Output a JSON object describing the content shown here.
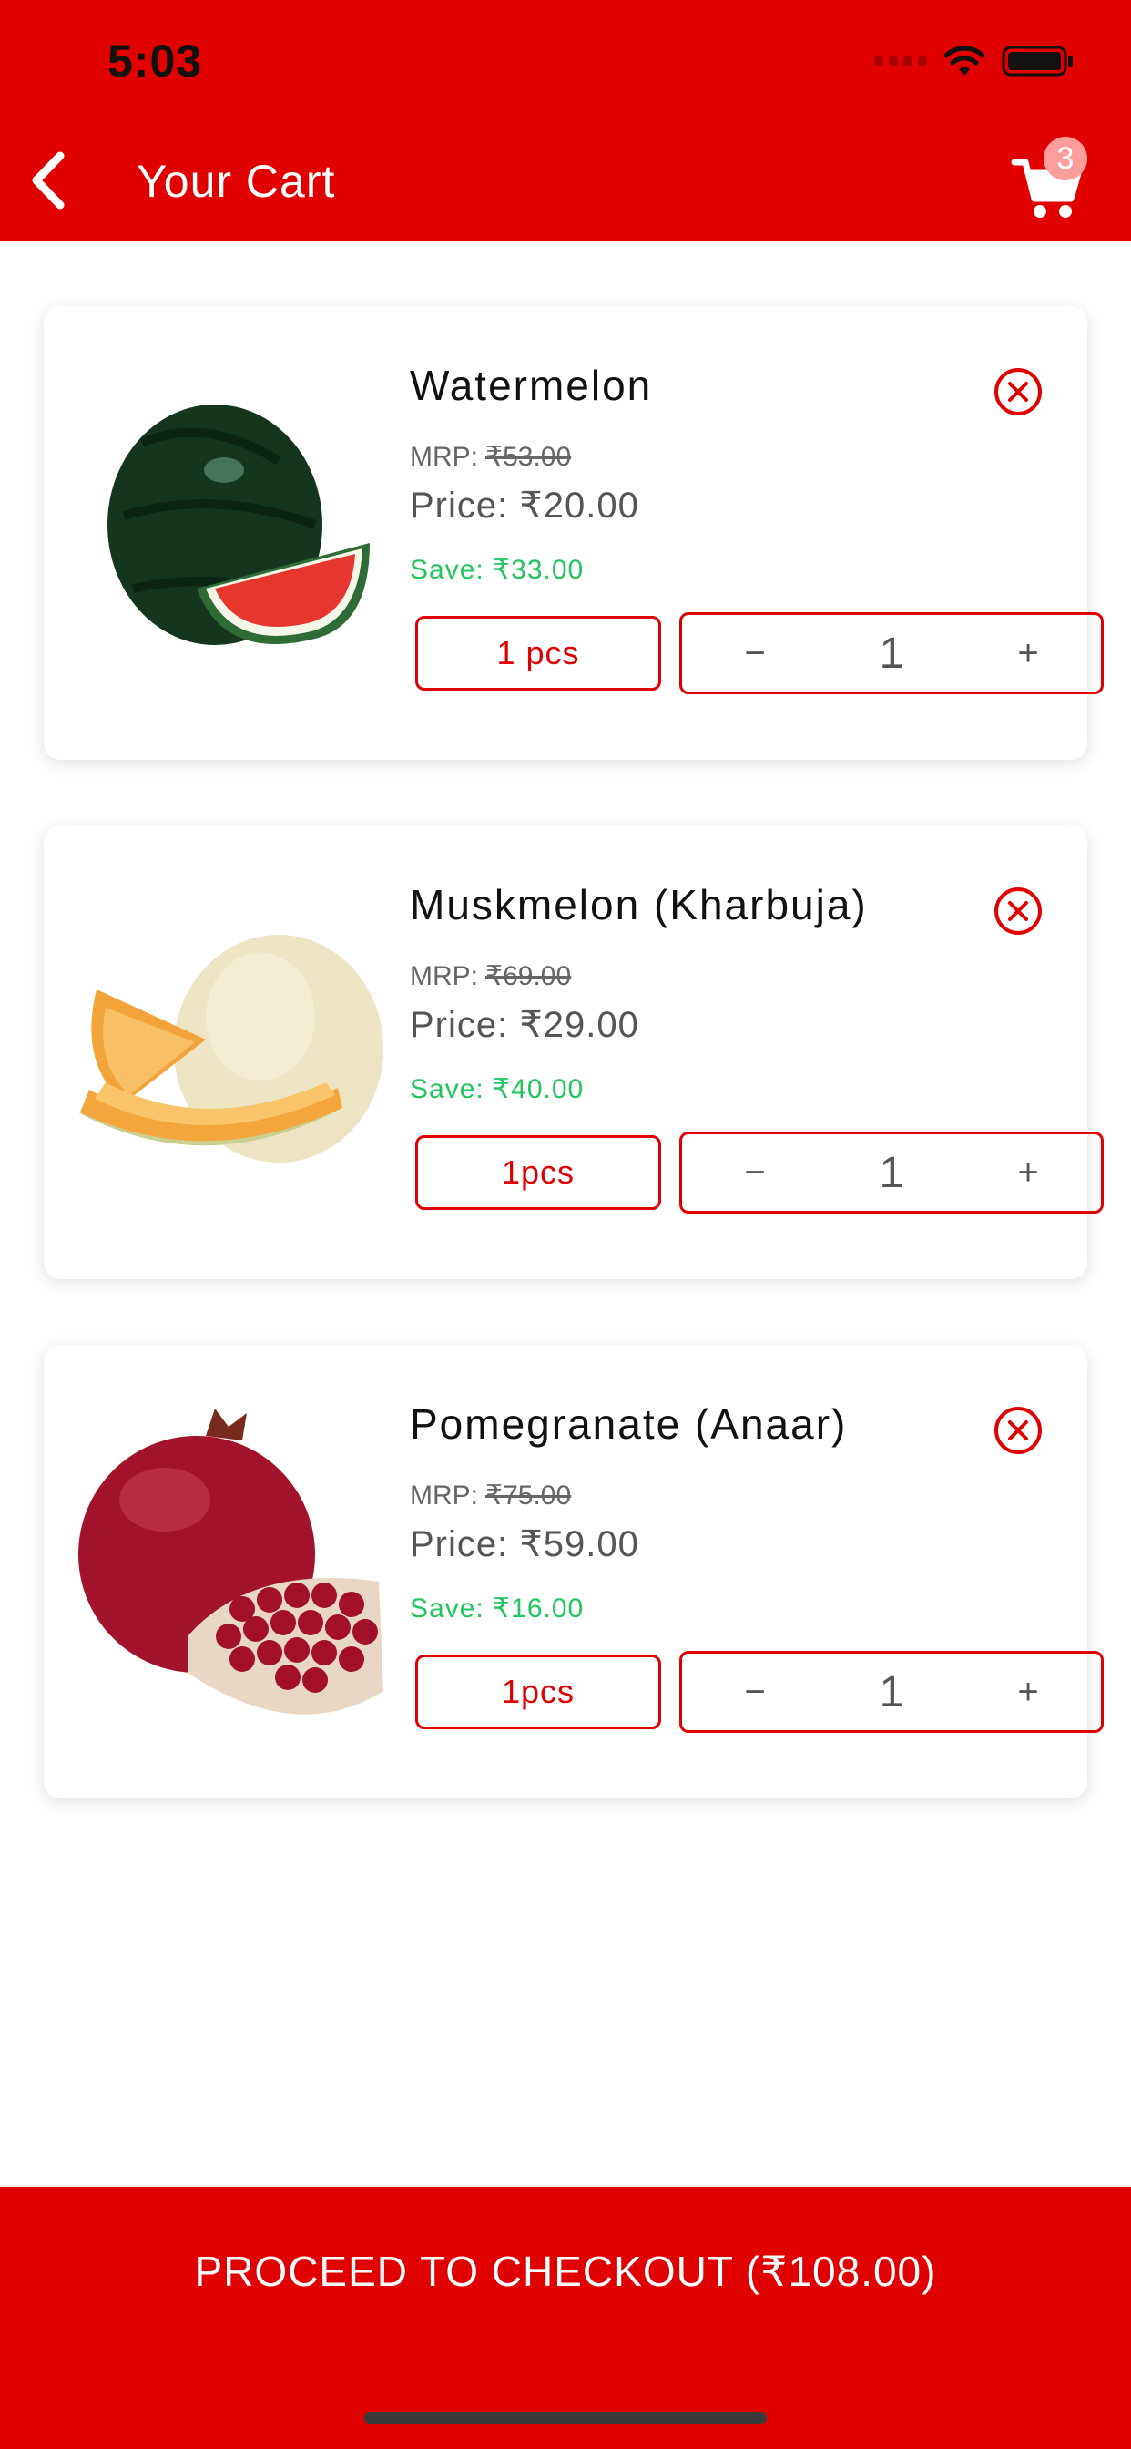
{
  "status_bar": {
    "time": "5:03"
  },
  "header": {
    "title": "Your Cart",
    "cart_count": "3"
  },
  "cart_items": [
    {
      "name": "Watermelon",
      "mrp_label": "MRP:",
      "mrp": "₹53.00",
      "price": "Price: ₹20.00",
      "save": "Save: ₹33.00",
      "unit": "1 pcs",
      "quantity": "1",
      "qty_minus": "−",
      "qty_plus": "+"
    },
    {
      "name": "Muskmelon (Kharbuja)",
      "mrp_label": "MRP:",
      "mrp": "₹69.00",
      "price": "Price: ₹29.00",
      "save": "Save: ₹40.00",
      "unit": "1pcs",
      "quantity": "1",
      "qty_minus": "−",
      "qty_plus": "+"
    },
    {
      "name": "Pomegranate (Anaar)",
      "mrp_label": "MRP:",
      "mrp": "₹75.00",
      "price": "Price: ₹59.00",
      "save": "Save: ₹16.00",
      "unit": "1pcs",
      "quantity": "1",
      "qty_minus": "−",
      "qty_plus": "+"
    }
  ],
  "checkout": {
    "label": "PROCEED TO CHECKOUT (₹108.00)"
  },
  "icons": {
    "back": "chevron-left-icon",
    "cart": "cart-icon",
    "remove": "close-circle-icon"
  },
  "colors": {
    "brand": "#e00000",
    "save": "#22c55e",
    "badge": "#ff9d9d"
  }
}
